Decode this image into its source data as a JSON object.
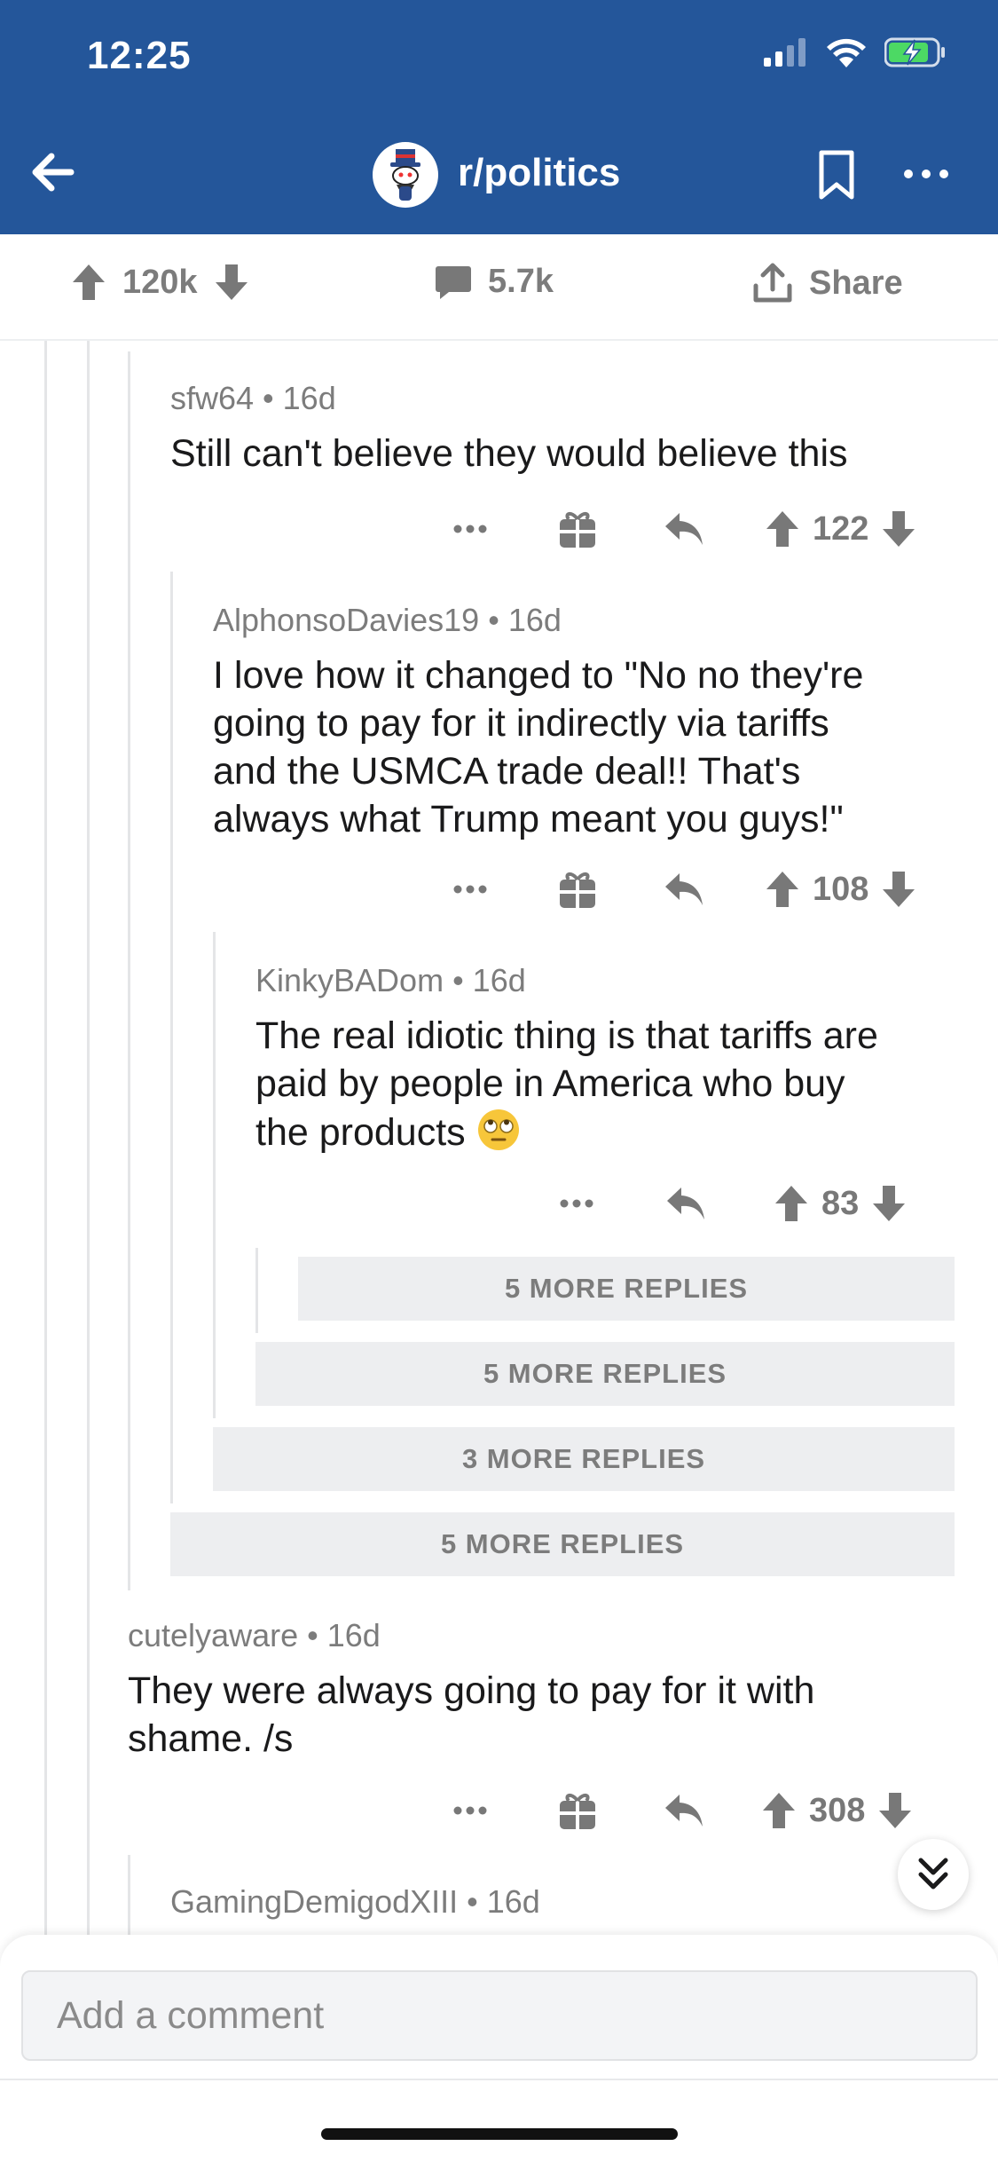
{
  "status_bar": {
    "time": "12:25"
  },
  "nav": {
    "subreddit": "r/politics"
  },
  "post_actions": {
    "votes": "120k",
    "comments": "5.7k",
    "share": "Share"
  },
  "comments": [
    {
      "author": "sfw64",
      "age": "16d",
      "body": "Still can't believe they would believe this",
      "score": "122"
    },
    {
      "author": "AlphonsoDavies19",
      "age": "16d",
      "body_lines": [
        "I love how it changed to \"No no they're",
        "going to pay for it indirectly via tariffs",
        "and the USMCA trade deal!! That's",
        "always what Trump meant you guys!\""
      ],
      "score": "108"
    },
    {
      "author": "KinkyBADom",
      "age": "16d",
      "body_lines": [
        "The real idiotic thing is that tariffs are",
        "paid by people in America who buy",
        "the products"
      ],
      "emoji": "face-with-rolling-eyes",
      "score": "83"
    },
    {
      "author": "cutelyaware",
      "age": "16d",
      "body_lines": [
        "They were always going to pay for it with",
        "shame. /s"
      ],
      "score": "308"
    },
    {
      "author": "GamingDemigodXIII",
      "age": "16d"
    }
  ],
  "more_replies": [
    "5 MORE REPLIES",
    "5 MORE REPLIES",
    "3 MORE REPLIES",
    "5 MORE REPLIES"
  ],
  "composer": {
    "placeholder": "Add a comment"
  },
  "colors": {
    "header": "#24569a",
    "meta_gray": "#7c7c7c",
    "more_bg": "#edeef0"
  },
  "icons": [
    "back-arrow-icon",
    "bookmark-icon",
    "more-dots-icon",
    "upvote-icon",
    "downvote-icon",
    "comment-icon",
    "share-icon",
    "gift-icon",
    "reply-icon",
    "chevron-double-down-icon"
  ]
}
